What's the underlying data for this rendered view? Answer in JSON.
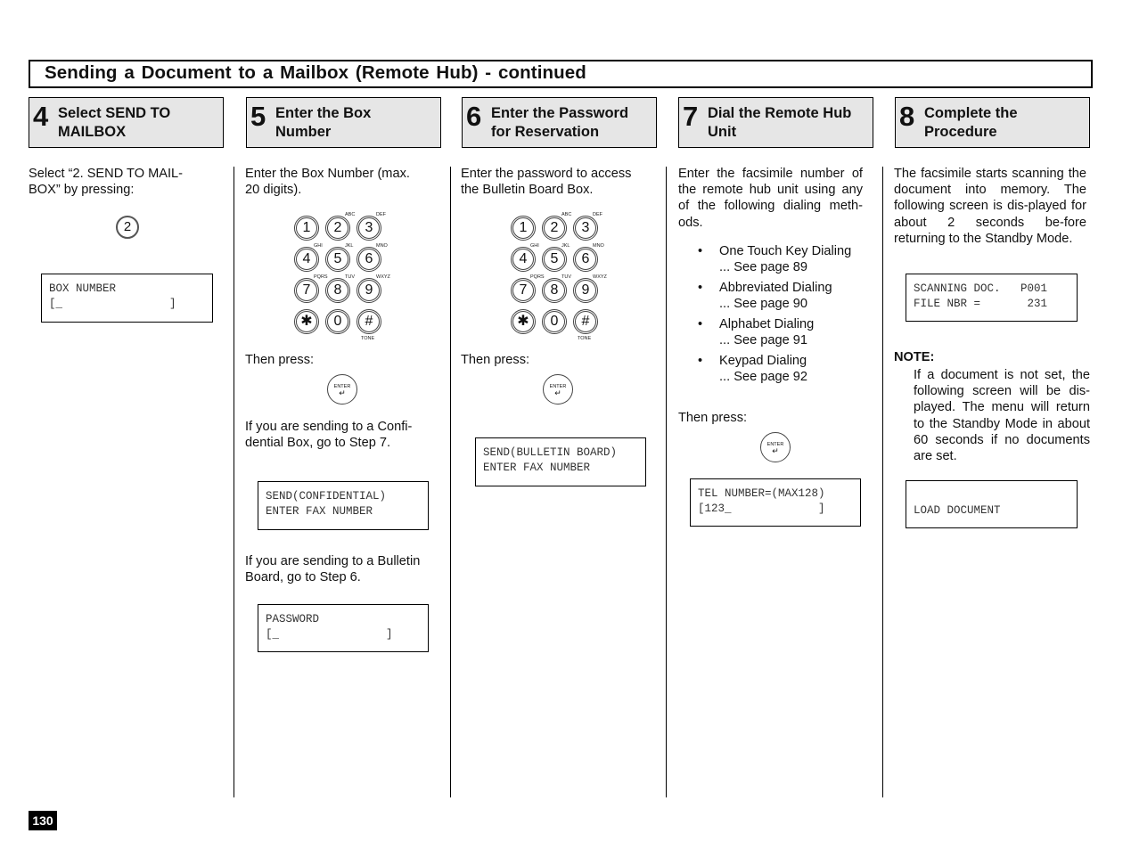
{
  "title": "Sending a Document to a Mailbox (Remote Hub) - continued",
  "page_number": "130",
  "steps": [
    {
      "num": "4",
      "title_l1": "Select SEND TO",
      "title_l2": "MAILBOX"
    },
    {
      "num": "5",
      "title_l1": "Enter the Box",
      "title_l2": "Number"
    },
    {
      "num": "6",
      "title_l1": "Enter the Password",
      "title_l2": "for Reservation"
    },
    {
      "num": "7",
      "title_l1": "Dial the Remote Hub",
      "title_l2": "Unit"
    },
    {
      "num": "8",
      "title_l1": "Complete the",
      "title_l2": "Procedure"
    }
  ],
  "col4": {
    "intro": "Select “2. SEND TO MAIL-BOX” by pressing:",
    "key": "2",
    "lcd": "BOX NUMBER\n[_                ]"
  },
  "col5": {
    "intro": "Enter the Box Number (max. 20 digits).",
    "then": "Then press:",
    "confidential_text": "If you are sending to a Confi-dential Box, go to Step 7.",
    "lcd_confidential": "SEND(CONFIDENTIAL)\nENTER FAX NUMBER",
    "bulletin_text": "If you are sending to a Bulletin Board, go to Step 6.",
    "lcd_password": "PASSWORD\n[_                ]"
  },
  "col6": {
    "intro": "Enter the password to access the Bulletin Board Box.",
    "then": "Then press:",
    "lcd": "SEND(BULLETIN BOARD)\nENTER FAX NUMBER"
  },
  "col7": {
    "intro": "Enter the facsimile number of the remote hub unit using any of the following dialing meth-ods.",
    "methods": [
      {
        "name": "One Touch Key Dialing",
        "ref": "... See page 89"
      },
      {
        "name": "Abbreviated Dialing",
        "ref": "... See page 90"
      },
      {
        "name": "Alphabet Dialing",
        "ref": "... See page 91"
      },
      {
        "name": "Keypad Dialing",
        "ref": "... See page 92"
      }
    ],
    "then": "Then press:",
    "lcd": "TEL NUMBER=(MAX128)\n[123_             ]"
  },
  "col8": {
    "intro": "The facsimile starts scanning the document into memory. The following screen is dis-played for about 2 seconds be-fore returning to the Standby Mode.",
    "lcd_scanning": "SCANNING DOC.   P001\nFILE NBR =       231",
    "note_heading": "NOTE:",
    "note_text": "If a document is not set, the following screen will be dis-played. The menu will return to the Standby Mode in about 60 seconds if no documents are set.",
    "lcd_load": "\nLOAD DOCUMENT"
  },
  "keypad": {
    "keys": [
      "1",
      "2",
      "3",
      "4",
      "5",
      "6",
      "7",
      "8",
      "9",
      "✱",
      "0",
      "#"
    ],
    "letters": {
      "2": "ABC",
      "3": "DEF",
      "4": "GHI",
      "5": "JKL",
      "6": "MNO",
      "7": "PQRS",
      "8": "TUV",
      "9": "WXYZ"
    },
    "tone_label": "TONE"
  },
  "enter_key": {
    "label": "ENTER",
    "arrow": "↵"
  }
}
